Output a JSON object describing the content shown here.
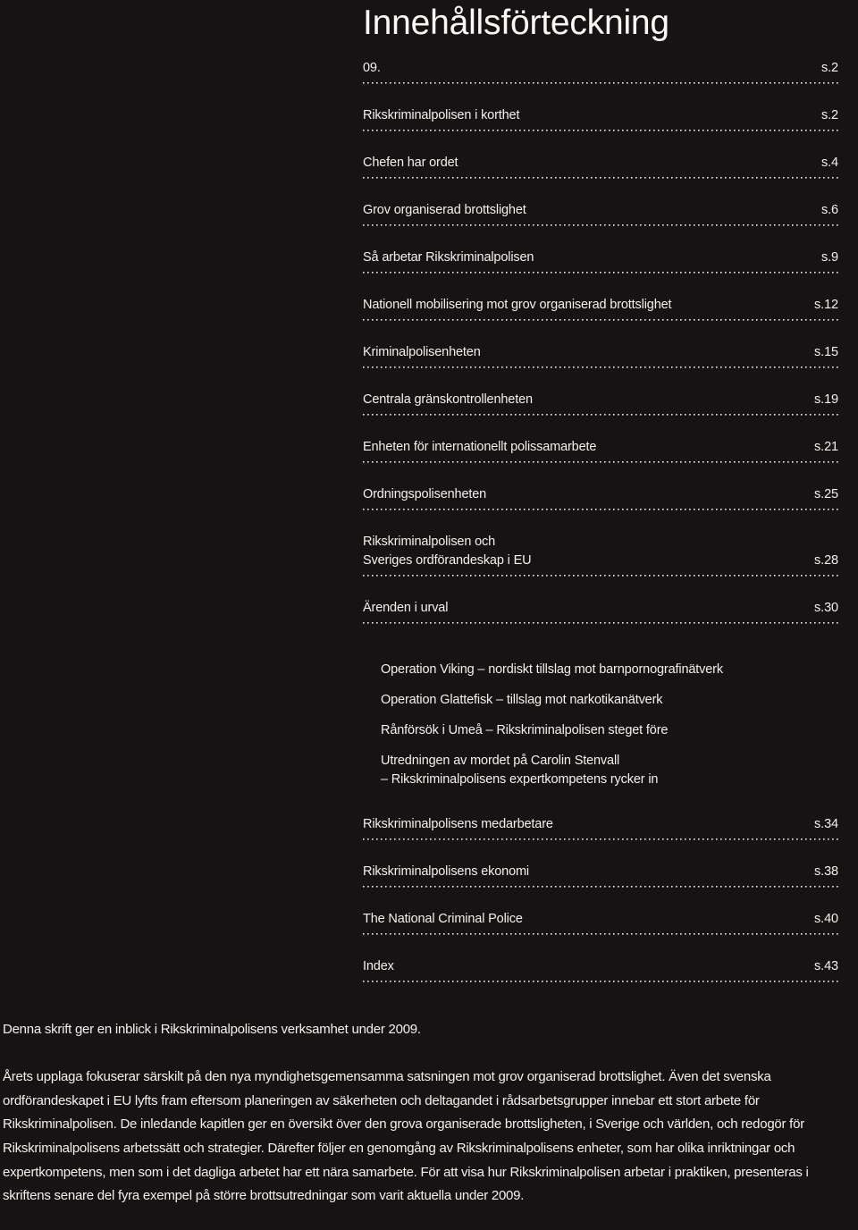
{
  "document": {
    "title": "Innehållsförteckning"
  },
  "toc": {
    "entries": [
      {
        "lines": [
          "09."
        ],
        "page": "s.2"
      },
      {
        "lines": [
          "Rikskriminalpolisen i korthet"
        ],
        "page": "s.2"
      },
      {
        "lines": [
          "Chefen har ordet"
        ],
        "page": "s.4"
      },
      {
        "lines": [
          "Grov organiserad brottslighet"
        ],
        "page": "s.6"
      },
      {
        "lines": [
          "Så arbetar Rikskriminalpolisen"
        ],
        "page": "s.9"
      },
      {
        "lines": [
          "Nationell mobilisering mot grov organiserad brottslighet"
        ],
        "page": "s.12"
      },
      {
        "lines": [
          "Kriminalpolisenheten"
        ],
        "page": "s.15"
      },
      {
        "lines": [
          "Centrala gränskontrollenheten"
        ],
        "page": "s.19"
      },
      {
        "lines": [
          "Enheten för internationellt polissamarbete"
        ],
        "page": "s.21"
      },
      {
        "lines": [
          "Ordningspolisenheten"
        ],
        "page": "s.25"
      },
      {
        "lines": [
          "Rikskriminalpolisen och",
          "Sveriges ordförandeskap i EU"
        ],
        "page": "s.28"
      },
      {
        "lines": [
          "Ärenden i urval"
        ],
        "page": "s.30"
      }
    ],
    "sub_entries": [
      {
        "lines": [
          "Operation Viking – nordiskt tillslag mot barnpornografinätverk"
        ]
      },
      {
        "lines": [
          "Operation Glattefisk – tillslag mot narkotikanätverk"
        ]
      },
      {
        "lines": [
          "Rånförsök i Umeå – Rikskriminalpolisen steget före"
        ]
      },
      {
        "lines": [
          "Utredningen av mordet på Carolin Stenvall",
          "– Rikskriminalpolisens expertkompetens rycker in"
        ]
      }
    ],
    "entries_after": [
      {
        "lines": [
          "Rikskriminalpolisens medarbetare"
        ],
        "page": "s.34"
      },
      {
        "lines": [
          "Rikskriminalpolisens ekonomi"
        ],
        "page": "s.38"
      },
      {
        "lines": [
          "The National Criminal Police"
        ],
        "page": "s.40"
      },
      {
        "lines": [
          "Index"
        ],
        "page": "s.43"
      }
    ]
  },
  "intro": {
    "lead": "Denna skrift ger en inblick i Rikskriminalpolisens verksamhet under 2009.",
    "body": "Årets upplaga fokuserar särskilt på den nya myndighetsgemensamma satsningen mot grov organiserad brottslighet. Även det svenska ordförandeskapet i EU lyfts fram eftersom planeringen av säkerheten och deltagandet i rådsarbetsgrupper innebar ett stort arbete för Rikskriminalpolisen. De inledande kapitlen ger en översikt över den grova organiserade brottsligheten, i Sverige och världen, och redogör för Rikskriminalpolisens arbetssätt och strategier. Därefter följer en genomgång av Rikskriminalpolisens enheter, som har olika inriktningar och expertkompetens, men som i det dagliga arbetet har ett nära samarbete. För att visa hur Rikskriminalpolisen arbetar i praktiken, presenteras i skriftens senare del fyra exempel på större brottsutredningar som varit aktuella under 2009."
  },
  "colors": {
    "background": "#151313",
    "text": "#f4f1ec",
    "leader_dots": "#e9e5de"
  }
}
